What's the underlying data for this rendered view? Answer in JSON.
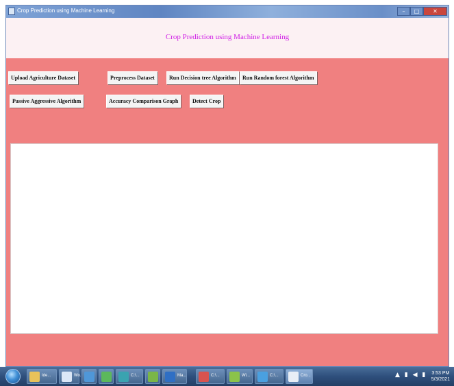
{
  "window": {
    "title": "Crop Prediction using Machine Learning",
    "controls": {
      "minimize": "–",
      "maximize": "□",
      "close": "✕"
    }
  },
  "header": {
    "heading": "Crop Prediction using Machine Learning",
    "heading_color": "#d01ee6"
  },
  "toolbar": {
    "upload": "Upload Agriculture Dataset",
    "preprocess": "Preprocess Dataset",
    "decision_tree": "Run Decision tree Algorithm",
    "random_forest": "Run Random forest Algorithm",
    "passive_aggressive": "Passive Aggressive Algorithm",
    "accuracy_graph": "Accuracy Comparison Graph",
    "detect_crop": "Detect Crop"
  },
  "output": {
    "text": ""
  },
  "colors": {
    "window_background": "#f08080",
    "header_background": "#fcf1f3",
    "output_background": "#ffffff"
  },
  "taskbar": {
    "buttons": [
      {
        "label": "Ide...",
        "icon": "folder-icon"
      },
      {
        "label": "Wo...",
        "icon": "document-icon"
      },
      {
        "label": "",
        "icon": "internet-explorer-icon"
      },
      {
        "label": "",
        "icon": "chrome-icon"
      },
      {
        "label": "C:\\...",
        "icon": "terminal-icon"
      },
      {
        "label": "",
        "icon": "python-icon"
      },
      {
        "label": "Ma...",
        "icon": "media-icon"
      },
      {
        "label": "C:\\...",
        "icon": "notepad-icon"
      },
      {
        "label": "Wi...",
        "icon": "window-icon"
      },
      {
        "label": "C:\\...",
        "icon": "command-icon"
      },
      {
        "label": "Cro...",
        "icon": "feather-icon"
      }
    ],
    "clock_time": "3:53 PM",
    "clock_date": "5/3/2021"
  }
}
